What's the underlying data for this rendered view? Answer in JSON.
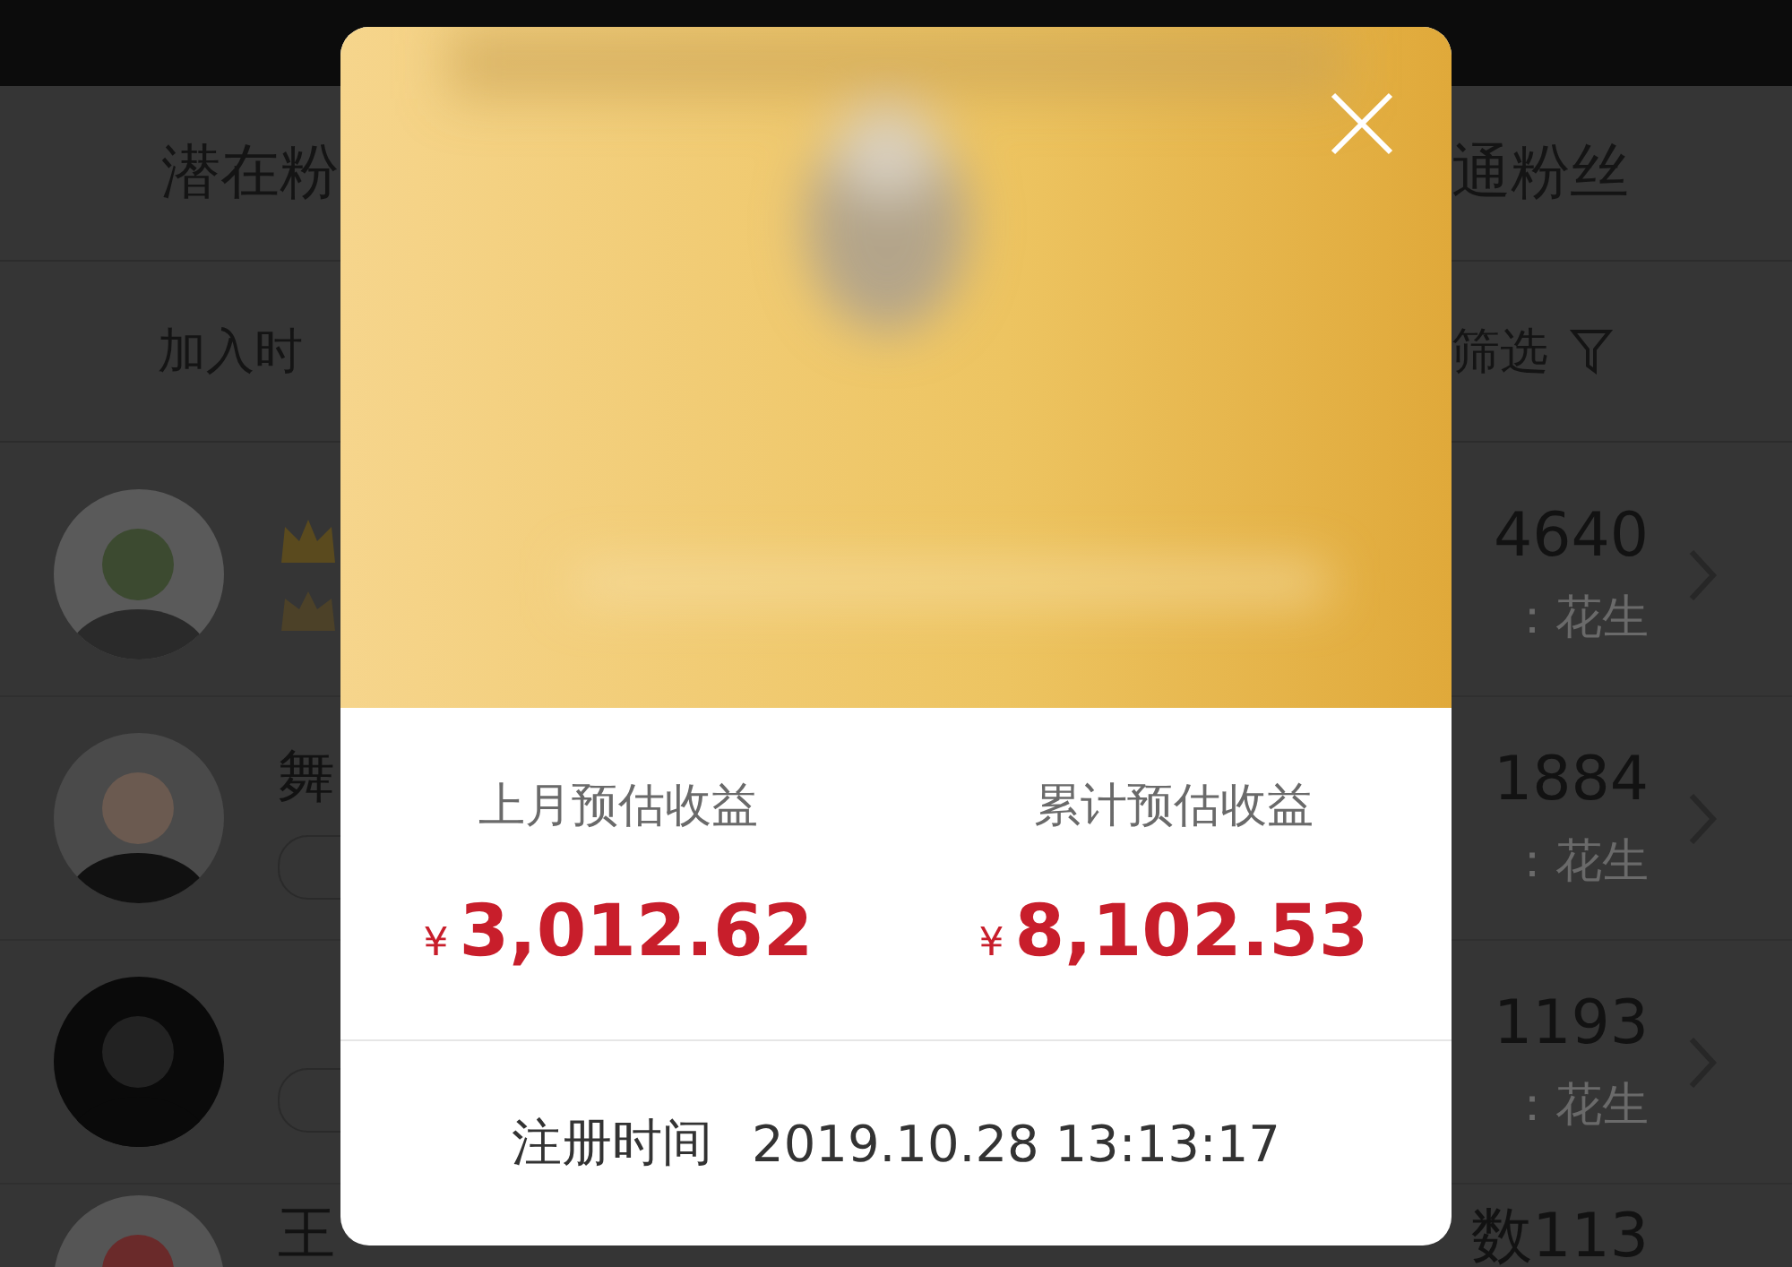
{
  "header": {
    "tab_left": "潜在粉",
    "tab_right": "通粉丝"
  },
  "filter": {
    "left": "加入时",
    "right": "筛选"
  },
  "fans": [
    {
      "kind": "crowns",
      "count": "4640",
      "source": "：花生"
    },
    {
      "kind": "text",
      "name": "舞",
      "count": "1884",
      "source": "：花生"
    },
    {
      "kind": "badge",
      "count": "1193",
      "source": "：花生"
    },
    {
      "kind": "text",
      "name": "王",
      "count": "数113"
    }
  ],
  "modal": {
    "stats": [
      {
        "label": "上月预估收益",
        "currency": "¥",
        "amount": "3,012.62"
      },
      {
        "label": "累计预估收益",
        "currency": "¥",
        "amount": "8,102.53"
      }
    ],
    "register": {
      "label": "注册时间",
      "value": "2019.10.28 13:13:17"
    }
  }
}
